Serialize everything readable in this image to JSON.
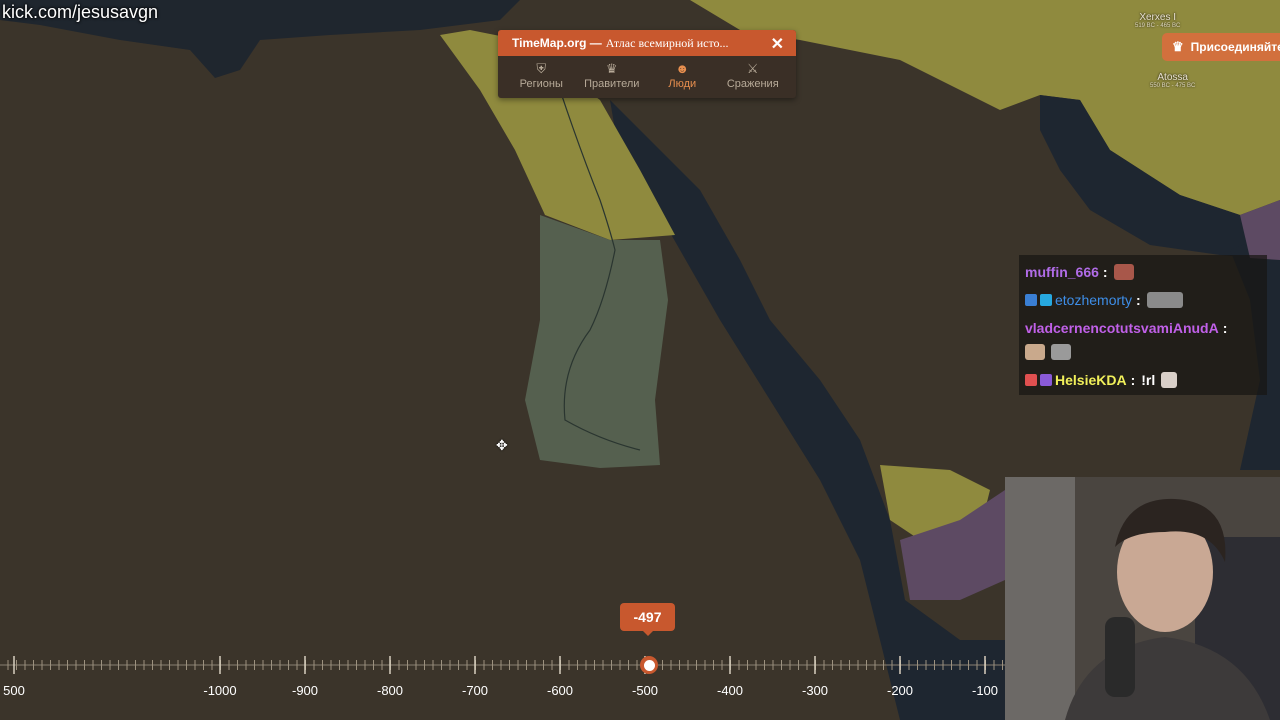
{
  "overlay": {
    "watermark": "kick.com/jesusavgn"
  },
  "map": {
    "labels": [
      {
        "name": "Xerxes I",
        "sub": "519 BC - 465 BC"
      },
      {
        "name": "Atossa",
        "sub": "550 BC - 475 BC"
      }
    ],
    "colors": {
      "land": "#3b342a",
      "sea": "#1e2630",
      "yellow": "#8f8a3e",
      "green": "#55604f",
      "purple": "#5d4a63"
    }
  },
  "join_button": {
    "label": "Присоединяйтесь",
    "icon": "crown-icon"
  },
  "panel": {
    "brand": "TimeMap.org —",
    "title": "Атлас всемирной исто...",
    "close": "✕",
    "tabs": [
      {
        "label": "Регионы",
        "icon": "shield-icon",
        "active": false
      },
      {
        "label": "Правители",
        "icon": "crown-icon",
        "active": false
      },
      {
        "label": "Люди",
        "icon": "people-icon",
        "active": true
      },
      {
        "label": "Сражения",
        "icon": "swords-icon",
        "active": false
      }
    ]
  },
  "chat": {
    "messages": [
      {
        "user": "muffin_666",
        "sep": ":",
        "text": ""
      },
      {
        "user": "etozhemorty",
        "sep": ":",
        "text": ""
      },
      {
        "user": "vladcernencotutsvamiAnudA",
        "sep": ":",
        "text": ""
      },
      {
        "user": "HelsieKDA",
        "sep": ":",
        "text": "!rl"
      }
    ]
  },
  "timeline": {
    "current_year": "-497",
    "ticks": [
      "500",
      "-1000",
      "-900",
      "-800",
      "-700",
      "-600",
      "-500",
      "-400",
      "-300",
      "-200",
      "-100"
    ]
  }
}
